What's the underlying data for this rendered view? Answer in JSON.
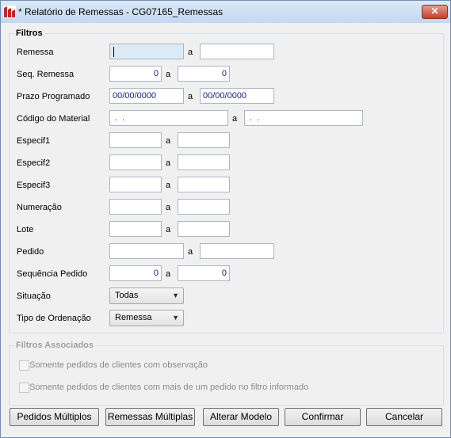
{
  "window": {
    "title": "* Relatório de Remessas - CG07165_Remessas",
    "close": "✕"
  },
  "filtros": {
    "legend": "Filtros",
    "sep": "a",
    "remessa": {
      "label": "Remessa",
      "from": "",
      "to": ""
    },
    "seq_remessa": {
      "label": "Seq. Remessa",
      "from": "0",
      "to": "0"
    },
    "prazo": {
      "label": "Prazo Programado",
      "from": "00/00/0000",
      "to": "00/00/0000"
    },
    "material": {
      "label": "Código do Material",
      "from": " .  .",
      "to": " .  ."
    },
    "especif1": {
      "label": "Especif1",
      "from": "",
      "to": ""
    },
    "especif2": {
      "label": "Especif2",
      "from": "",
      "to": ""
    },
    "especif3": {
      "label": "Especif3",
      "from": "",
      "to": ""
    },
    "numeracao": {
      "label": "Numeração",
      "from": "",
      "to": ""
    },
    "lote": {
      "label": "Lote",
      "from": "",
      "to": ""
    },
    "pedido": {
      "label": "Pedido",
      "from": "",
      "to": ""
    },
    "seq_pedido": {
      "label": "Sequência Pedido",
      "from": "0",
      "to": "0"
    },
    "situacao": {
      "label": "Situação",
      "value": "Todas"
    },
    "ordenacao": {
      "label": "Tipo de Ordenação",
      "value": "Remessa"
    }
  },
  "associados": {
    "legend": "Filtros Associados",
    "obs": "Somente pedidos de clientes com observação",
    "multi": "Somente pedidos de clientes com mais de um pedido no filtro informado"
  },
  "buttons": {
    "pedidos": "Pedidos Múltiplos",
    "remessas": "Remessas Múltiplas",
    "alterar": "Alterar Modelo",
    "confirmar": "Confirmar",
    "cancelar": "Cancelar"
  },
  "icons": {
    "app": "app-logo-icon",
    "close": "close-icon",
    "dropdown": "chevron-down-icon"
  }
}
